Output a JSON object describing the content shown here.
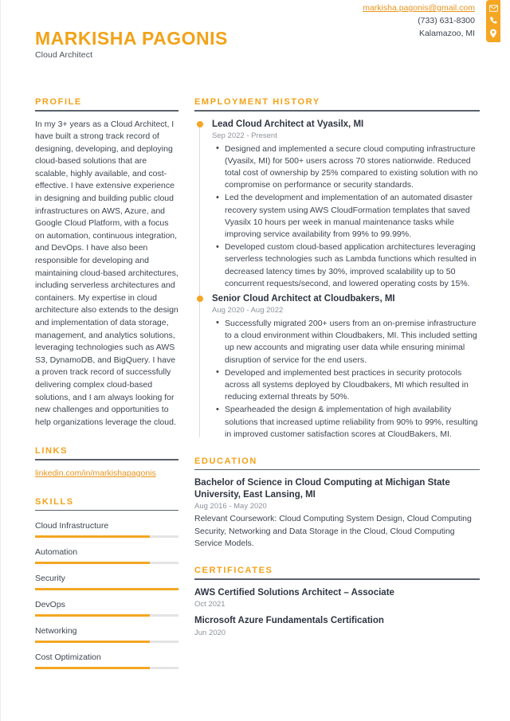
{
  "header": {
    "name": "MARKISHA PAGONIS",
    "job_title": "Cloud Architect",
    "contact": {
      "email": "markisha.pagonis@gmail.com",
      "phone": "(733) 631-8300",
      "location": "Kalamazoo, MI"
    },
    "icons": [
      "envelope-icon",
      "phone-icon",
      "location-pin-icon"
    ]
  },
  "colors": {
    "accent": "#f5a623",
    "heading": "#f2a218",
    "link": "#e8941a",
    "text": "#3d4450",
    "muted": "#8d929b",
    "rule": "#5a616c",
    "track": "#e4e4e4"
  },
  "sections": {
    "profile": {
      "title": "PROFILE",
      "text": "In my 3+ years as a Cloud Architect, I have built a strong track record of designing, developing, and deploying cloud-based solutions that are scalable, highly available, and cost-effective. I have extensive experience in designing and building public cloud infrastructures on AWS, Azure, and Google Cloud Platform, with a focus on automation, continuous integration, and DevOps. I have also been responsible for developing and maintaining cloud-based architectures, including serverless architectures and containers. My expertise in cloud architecture also extends to the design and implementation of data storage, management, and analytics solutions, leveraging technologies such as AWS S3, DynamoDB, and BigQuery. I have a proven track record of successfully delivering complex cloud-based solutions, and I am always looking for new challenges and opportunities to help organizations leverage the cloud."
    },
    "links": {
      "title": "LINKS",
      "items": [
        {
          "label": "linkedin.com/in/markishapagonis"
        }
      ]
    },
    "skills": {
      "title": "SKILLS",
      "items": [
        {
          "label": "Cloud Infrastructure",
          "level": 80
        },
        {
          "label": "Automation",
          "level": 80
        },
        {
          "label": "Security",
          "level": 100
        },
        {
          "label": "DevOps",
          "level": 80
        },
        {
          "label": "Networking",
          "level": 80
        },
        {
          "label": "Cost Optimization",
          "level": 80
        }
      ]
    },
    "employment": {
      "title": "EMPLOYMENT HISTORY",
      "jobs": [
        {
          "title": "Lead Cloud Architect at Vyasilx, MI",
          "date": "Sep 2022 - Present",
          "bullets": [
            "Designed and implemented a secure cloud computing infrastructure (Vyasilx, MI) for 500+ users across 70 stores nationwide. Reduced total cost of ownership by 25% compared to existing solution with no compromise on performance or security standards.",
            "Led the development and implementation of an automated disaster recovery system using AWS CloudFormation templates that saved Vyasilx 10 hours per week in manual maintenance tasks while improving service availability from 99% to 99.99%.",
            "Developed custom cloud-based application architectures leveraging serverless technologies such as Lambda functions which resulted in decreased latency times by 30%, improved scalability up to 50 concurrent requests/second, and lowered operating costs by 15%."
          ]
        },
        {
          "title": "Senior Cloud Architect at Cloudbakers, MI",
          "date": "Aug 2020 - Aug 2022",
          "bullets": [
            "Successfully migrated 200+ users from an on-premise infrastructure to a cloud environment within Cloudbakers, MI. This included setting up new accounts and migrating user data while ensuring minimal disruption of service for the end users.",
            "Developed and implemented best practices in security protocols across all systems deployed by Cloudbakers, MI which resulted in reducing external threats by 50%.",
            "Spearheaded the design & implementation of high availability solutions that increased uptime reliability from 90% to 99%, resulting in improved customer satisfaction scores at CloudBakers, MI."
          ]
        }
      ]
    },
    "education": {
      "title": "EDUCATION",
      "entries": [
        {
          "title": "Bachelor of Science in Cloud Computing at Michigan State University, East Lansing, MI",
          "date": "Aug 2016 - May 2020",
          "description": "Relevant Coursework: Cloud Computing System Design, Cloud Computing Security, Networking and Data Storage in the Cloud, Cloud Computing Service Models."
        }
      ]
    },
    "certificates": {
      "title": "CERTIFICATES",
      "entries": [
        {
          "title": "AWS Certified Solutions Architect – Associate",
          "date": "Oct 2021"
        },
        {
          "title": "Microsoft Azure Fundamentals Certification",
          "date": "Jun 2020"
        }
      ]
    }
  }
}
